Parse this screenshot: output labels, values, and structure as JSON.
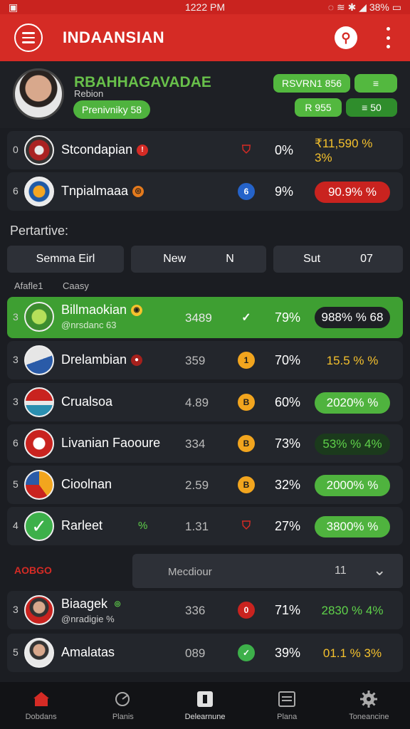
{
  "status": {
    "time": "1222 PM",
    "battery": "38%"
  },
  "appbar": {
    "title": "INDAANSIAN"
  },
  "profile": {
    "name": "RBAHHAGAVADAE",
    "subtitle": "Rebion",
    "tag": "Prenivniky 58",
    "pill1": "RSVRN1 856",
    "pill2": "≡",
    "pill3": "R 955",
    "pill4": "≡ 50"
  },
  "top_rows": [
    {
      "rank": "0",
      "name": "Stcondapian",
      "pct": "0%",
      "score": "₹11,590 % 3%",
      "score_color": "#f5c12d"
    },
    {
      "rank": "6",
      "name": "Tnpialmaaa",
      "pct": "9%",
      "score": "90.9% %",
      "score_color": "#ffffff"
    }
  ],
  "section_label": "Pertartive:",
  "filters": [
    {
      "a": "Semma Eirl",
      "b": ""
    },
    {
      "a": "New",
      "b": "N"
    },
    {
      "a": "Sut",
      "b": "07"
    }
  ],
  "col_headers": [
    "Afafle1",
    "Caasy"
  ],
  "rows": [
    {
      "rank": "3",
      "name": "Billmaokian",
      "sub": "@nrsdanc 63",
      "num": "3489",
      "pct": "79%",
      "score": "988% % 68"
    },
    {
      "rank": "3",
      "name": "Drelambian",
      "sub": "",
      "num": "359",
      "pct": "70%",
      "score": "15.5 % %"
    },
    {
      "rank": "3",
      "name": "Crualsoa",
      "sub": "",
      "num": "4.89",
      "pct": "60%",
      "score": "2020% %"
    },
    {
      "rank": "6",
      "name": "Livanian Faooure",
      "sub": "",
      "num": "334",
      "pct": "73%",
      "score": "53% % 4%"
    },
    {
      "rank": "5",
      "name": "Cioolnan",
      "sub": "",
      "num": "2.59",
      "pct": "32%",
      "score": "2000% %"
    },
    {
      "rank": "4",
      "name": "Rarleet",
      "sub": "",
      "extra": "%",
      "num": "1.31",
      "pct": "27%",
      "score": "3800% %"
    }
  ],
  "section2": {
    "label": "AOBGO",
    "select": "Mecdiour",
    "right": "11"
  },
  "bottom_rows": [
    {
      "rank": "3",
      "name": "Biaagek",
      "sub": "@nradigie %",
      "num": "336",
      "pct": "71%",
      "score": "2830 % 4%"
    },
    {
      "rank": "5",
      "name": "Amalatas",
      "sub": "",
      "num": "089",
      "pct": "39%",
      "score": "01.1 % 3%"
    }
  ],
  "nav": [
    {
      "label": "Dobdans",
      "icon": "home-icon"
    },
    {
      "label": "Planis",
      "icon": "chart-icon"
    },
    {
      "label": "Delearnune",
      "icon": "card-icon"
    },
    {
      "label": "Plana",
      "icon": "list-icon"
    },
    {
      "label": "Toneancine",
      "icon": "settings-icon"
    }
  ]
}
